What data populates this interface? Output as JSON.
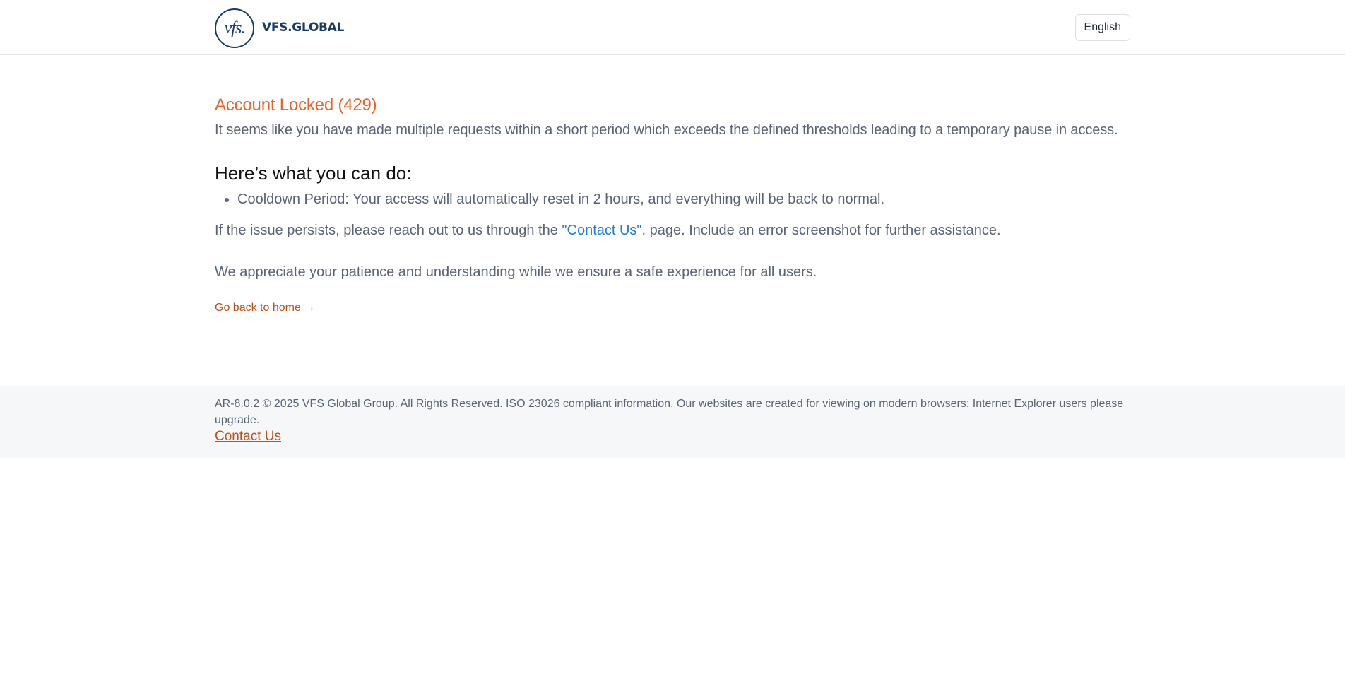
{
  "header": {
    "logo_mark": "vfs.",
    "logo_text": "VFS.GLOBAL",
    "language_label": "English"
  },
  "main": {
    "title": "Account Locked (429)",
    "lead": "It seems like you have made multiple requests within a short period which exceeds the defined thresholds leading to a temporary pause in access.",
    "subheading": "Here’s what you can do:",
    "tips": [
      "Cooldown Period: Your access will automatically reset in 2 hours, and everything will be back to normal."
    ],
    "persist_before": "If the issue persists, please reach out to us through the ",
    "persist_link": "\"Contact Us\"",
    "persist_after": ". page. Include an error screenshot for further assistance.",
    "appreciate": "We appreciate your patience and understanding while we ensure a safe experience for all users.",
    "home_link": "Go back to home →"
  },
  "footer": {
    "copyright": "AR-8.0.2 © 2025 VFS Global Group. All Rights Reserved. ISO 23026 compliant information. Our websites are created for viewing on modern browsers; Internet Explorer users please upgrade.",
    "contact_label": "Contact Us"
  },
  "colors": {
    "brand_navy": "#1c3c63",
    "title_orange": "#e8642b",
    "link_orange": "#c24f18",
    "link_blue": "#1e7de0",
    "body_text": "#5b6474",
    "footer_bg": "#f6f7f9"
  }
}
